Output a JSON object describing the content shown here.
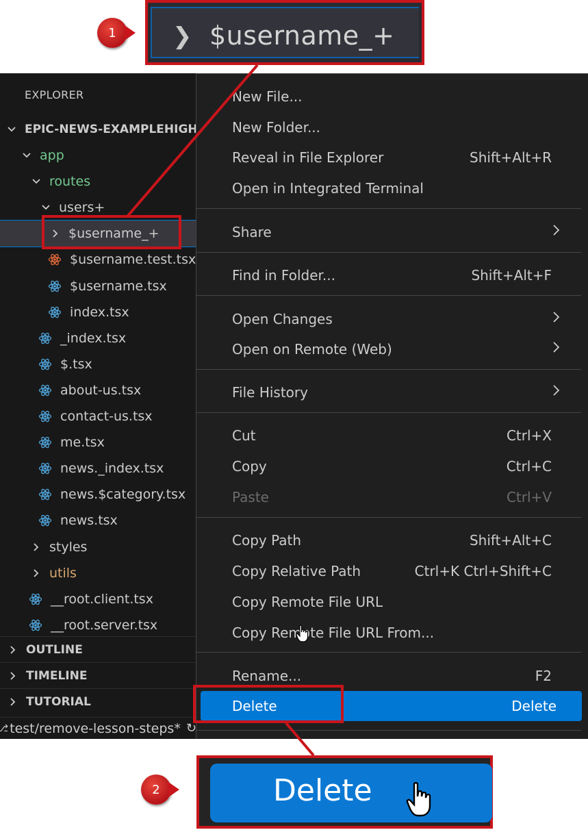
{
  "callout1": {
    "badge": "1",
    "label": "$username_+"
  },
  "callout2": {
    "badge": "2",
    "label": "Delete"
  },
  "sidebar": {
    "title": "EXPLORER",
    "root": "EPIC-NEWS-EXAMPLEHIGHI",
    "tree": [
      {
        "label": "app",
        "kind": "folder-open",
        "tone": "green"
      },
      {
        "label": "routes",
        "kind": "folder-open",
        "tone": "green"
      },
      {
        "label": "users+",
        "kind": "folder-open",
        "tone": "plain"
      },
      {
        "label": "$username_+",
        "kind": "folder-closed",
        "tone": "plain",
        "selected": true
      },
      {
        "label": "$username.test.tsx",
        "kind": "file",
        "tone": "plain",
        "icon": "react-test-icon"
      },
      {
        "label": "$username.tsx",
        "kind": "file",
        "tone": "plain",
        "icon": "react-icon"
      },
      {
        "label": "index.tsx",
        "kind": "file",
        "tone": "plain",
        "icon": "react-icon"
      },
      {
        "label": "_index.tsx",
        "kind": "file",
        "tone": "plain",
        "icon": "react-icon"
      },
      {
        "label": "$.tsx",
        "kind": "file",
        "tone": "plain",
        "icon": "react-icon"
      },
      {
        "label": "about-us.tsx",
        "kind": "file",
        "tone": "plain",
        "icon": "react-icon"
      },
      {
        "label": "contact-us.tsx",
        "kind": "file",
        "tone": "plain",
        "icon": "react-icon"
      },
      {
        "label": "me.tsx",
        "kind": "file",
        "tone": "plain",
        "icon": "react-icon"
      },
      {
        "label": "news._index.tsx",
        "kind": "file",
        "tone": "plain",
        "icon": "react-icon"
      },
      {
        "label": "news.$category.tsx",
        "kind": "file",
        "tone": "plain",
        "icon": "react-icon"
      },
      {
        "label": "news.tsx",
        "kind": "file",
        "tone": "plain",
        "icon": "react-icon"
      },
      {
        "label": "styles",
        "kind": "folder-closed",
        "tone": "plain"
      },
      {
        "label": "utils",
        "kind": "folder-closed",
        "tone": "orange"
      },
      {
        "label": "__root.client.tsx",
        "kind": "file",
        "tone": "plain",
        "icon": "react-icon"
      },
      {
        "label": "__root.server.tsx",
        "kind": "file",
        "tone": "plain",
        "icon": "react-icon"
      }
    ],
    "panels": [
      "OUTLINE",
      "TIMELINE",
      "TUTORIAL"
    ]
  },
  "statusbar": {
    "branch": "test/remove-lesson-steps*"
  },
  "menu": {
    "items": [
      {
        "label": "New File...",
        "shortcut": ""
      },
      {
        "label": "New Folder...",
        "shortcut": ""
      },
      {
        "label": "Reveal in File Explorer",
        "shortcut": "Shift+Alt+R"
      },
      {
        "label": "Open in Integrated Terminal",
        "shortcut": ""
      },
      {
        "label": "Share",
        "shortcut": "",
        "submenu": true
      },
      {
        "label": "Find in Folder...",
        "shortcut": "Shift+Alt+F"
      },
      {
        "label": "Open Changes",
        "shortcut": "",
        "submenu": true
      },
      {
        "label": "Open on Remote (Web)",
        "shortcut": "",
        "submenu": true
      },
      {
        "label": "File History",
        "shortcut": "",
        "submenu": true
      },
      {
        "label": "Cut",
        "shortcut": "Ctrl+X"
      },
      {
        "label": "Copy",
        "shortcut": "Ctrl+C"
      },
      {
        "label": "Paste",
        "shortcut": "Ctrl+V",
        "disabled": true
      },
      {
        "label": "Copy Path",
        "shortcut": "Shift+Alt+C"
      },
      {
        "label": "Copy Relative Path",
        "shortcut": "Ctrl+K Ctrl+Shift+C"
      },
      {
        "label": "Copy Remote File URL",
        "shortcut": ""
      },
      {
        "label": "Copy Remote File URL From...",
        "shortcut": ""
      },
      {
        "label": "Rename...",
        "shortcut": "F2"
      },
      {
        "label": "Delete",
        "shortcut": "Delete",
        "highlighted": true
      }
    ]
  },
  "colors": {
    "annotation_red": "#c8151b",
    "menu_highlight": "#0078d4",
    "folder_green": "#73c991",
    "folder_orange": "#d7a86e",
    "react_blue": "#4fa3d9",
    "react_test_orange": "#e0693a"
  }
}
